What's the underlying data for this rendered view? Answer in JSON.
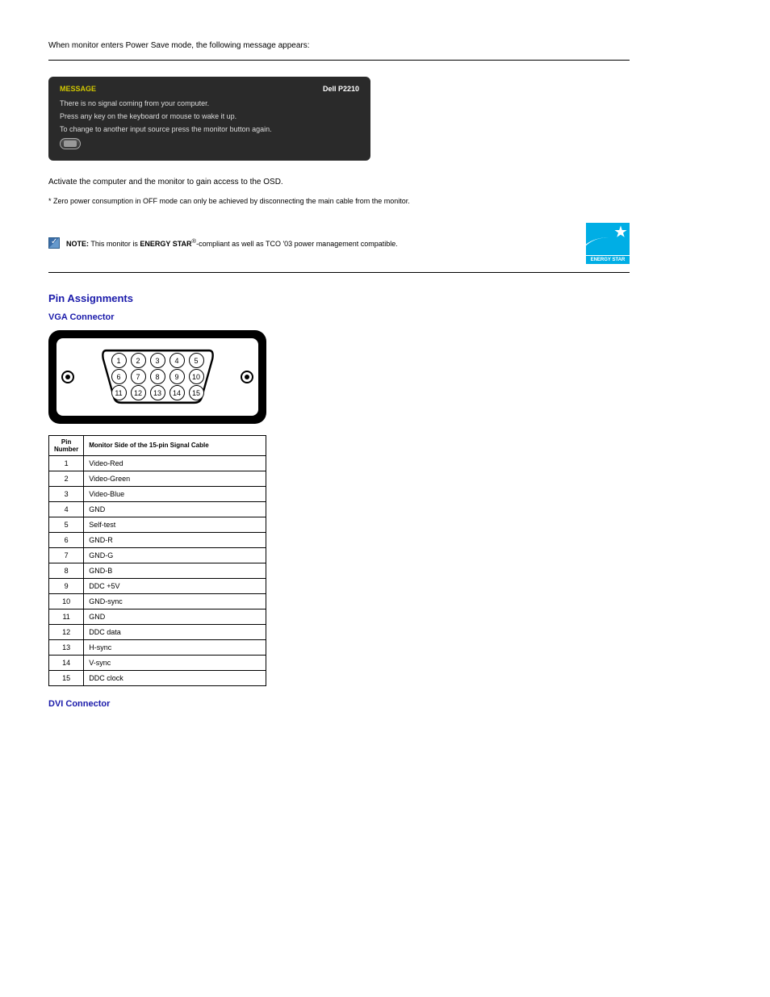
{
  "intro_text_top": "When monitor enters Power Save mode, the following message appears:",
  "osd": {
    "title": "MESSAGE",
    "model": "Dell P2210",
    "line1": "There is no signal coming from your computer.",
    "line2": "Press any key on the keyboard or mouse to wake it up.",
    "line3": "To change to another input source press the monitor button again."
  },
  "body_after_osd_1": "Activate the computer and the monitor to gain access to the OSD.",
  "body_after_osd_2": "* Zero power consumption in OFF mode can only be achieved by disconnecting the main cable from the monitor.",
  "note": {
    "label": "NOTE:",
    "text_before": "This monitor is ",
    "bold": "ENERGY STAR",
    "reg": "®",
    "text_after": "-compliant as well as TCO '03 power management compatible."
  },
  "energy_star_label": "ENERGY STAR",
  "section_heading": "Pin Assignments",
  "vga_heading": "VGA Connector",
  "dvi_heading": "DVI Connector",
  "vga_pins_row1": [
    "1",
    "2",
    "3",
    "4",
    "5"
  ],
  "vga_pins_row2": [
    "6",
    "7",
    "8",
    "9",
    "10"
  ],
  "vga_pins_row3": [
    "11",
    "12",
    "13",
    "14",
    "15"
  ],
  "pin_table": {
    "header1": "Pin Number",
    "header2": "Monitor Side of the 15-pin Signal Cable",
    "rows": [
      {
        "n": "1",
        "s": "Video-Red"
      },
      {
        "n": "2",
        "s": "Video-Green"
      },
      {
        "n": "3",
        "s": "Video-Blue"
      },
      {
        "n": "4",
        "s": "GND"
      },
      {
        "n": "5",
        "s": "Self-test"
      },
      {
        "n": "6",
        "s": "GND-R"
      },
      {
        "n": "7",
        "s": "GND-G"
      },
      {
        "n": "8",
        "s": "GND-B"
      },
      {
        "n": "9",
        "s": "DDC +5V"
      },
      {
        "n": "10",
        "s": "GND-sync"
      },
      {
        "n": "11",
        "s": "GND"
      },
      {
        "n": "12",
        "s": "DDC data"
      },
      {
        "n": "13",
        "s": "H-sync"
      },
      {
        "n": "14",
        "s": "V-sync"
      },
      {
        "n": "15",
        "s": "DDC clock"
      }
    ]
  }
}
